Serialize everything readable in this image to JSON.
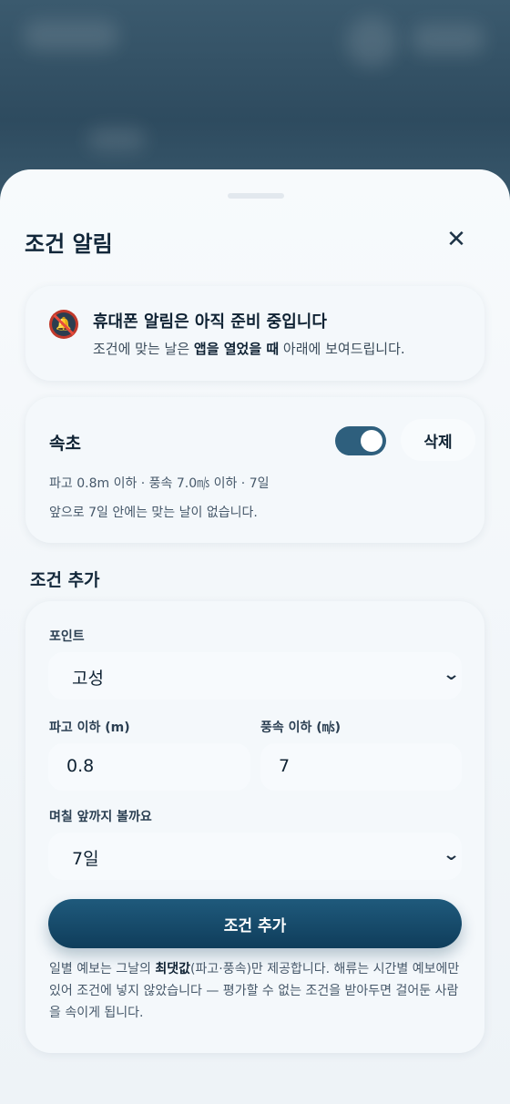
{
  "sheet": {
    "title": "조건 알림"
  },
  "notice": {
    "heading": "휴대폰 알림은 아직 준비 중입니다",
    "text_before": "조건에 맞는 날은 ",
    "text_bold": "앱을 열었을 때",
    "text_after": " 아래에 보여드립니다."
  },
  "condition": {
    "name": "속초",
    "enabled": true,
    "delete_label": "삭제",
    "summary": "파고 0.8m 이하 · 풍속 7.0㎧ 이하 · 7일",
    "status": "앞으로 7일 안에는 맞는 날이 없습니다."
  },
  "add_section": {
    "title": "조건 추가"
  },
  "form": {
    "point_label": "포인트",
    "point_value": "고성",
    "wave_label": "파고 이하 (m)",
    "wave_value": "0.8",
    "wind_label": "풍속 이하 (㎧)",
    "wind_value": "7",
    "days_label": "며칠 앞까지 볼까요",
    "days_value": "7일",
    "submit_label": "조건 추가",
    "footnote_before": "일별 예보는 그날의 ",
    "footnote_bold": "최댓값",
    "footnote_after": "(파고·풍속)만 제공합니다. 해류는 시간별 예보에만 있어 조건에 넣지 않았습니다 — 평가할 수 없는 조건을 받아두면 걸어둔 사람을 속이게 됩니다."
  },
  "icons": {
    "close": "close-icon",
    "bell_muted": "bell-muted-icon",
    "chevron": "chevron-down-icon"
  },
  "colors": {
    "accent": "#2e5f7d",
    "button": "#0f3d5b"
  }
}
